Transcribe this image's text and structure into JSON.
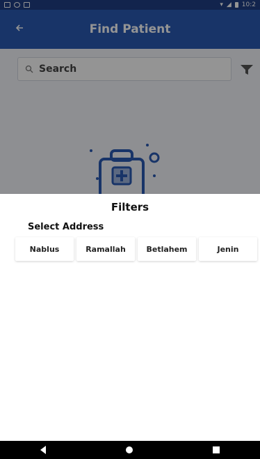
{
  "status_bar": {
    "time": "10:2"
  },
  "app_bar": {
    "title": "Find Patient"
  },
  "search": {
    "placeholder": "Search"
  },
  "filters_sheet": {
    "title": "Filters",
    "section_label": "Select Address",
    "options": [
      "Nablus",
      "Ramallah",
      "Betlahem",
      "Jenin"
    ]
  },
  "colors": {
    "primary": "#2a5bb4",
    "status_bar": "#1f3f86",
    "nav_bar": "#000000"
  },
  "icons": {
    "back": "arrow-left",
    "search": "magnifier",
    "filter": "funnel",
    "illustration": "medical-bag"
  }
}
